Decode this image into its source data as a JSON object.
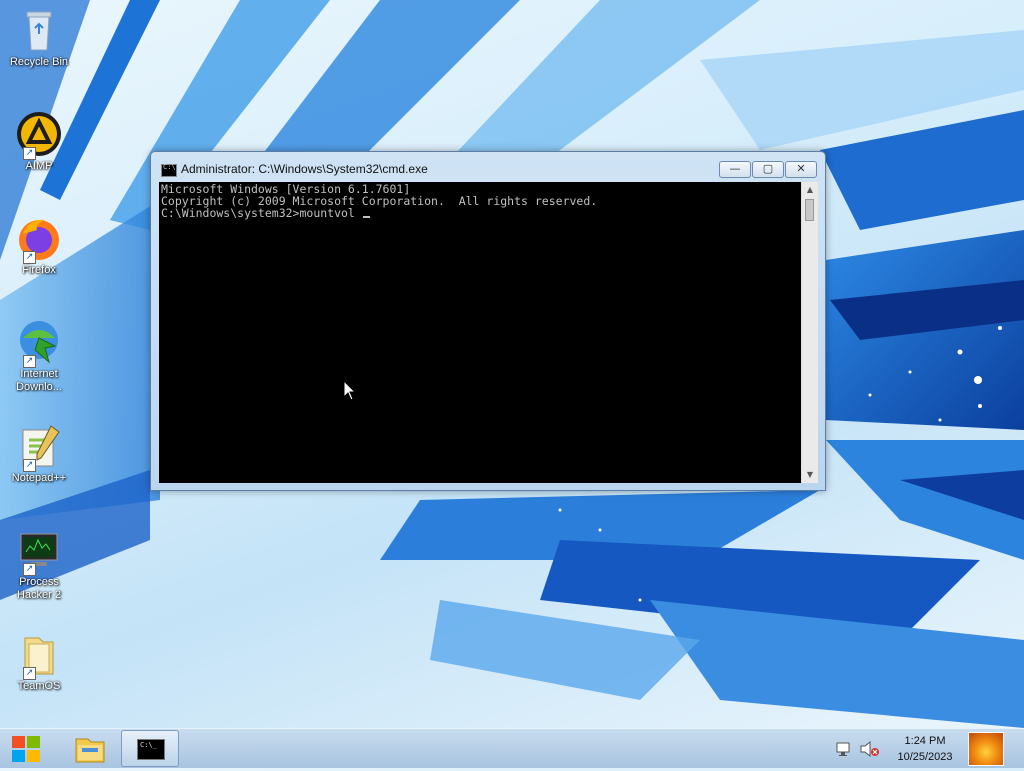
{
  "desktop": {
    "icons": [
      {
        "label": "Recycle Bin"
      },
      {
        "label": "AIMP"
      },
      {
        "label": "Firefox"
      },
      {
        "label": "Internet Downlo..."
      },
      {
        "label": "Notepad++"
      },
      {
        "label": "Process Hacker 2"
      },
      {
        "label": "TeamOS"
      }
    ]
  },
  "cmd_window": {
    "title": "Administrator: C:\\Windows\\System32\\cmd.exe",
    "minimize_glyph": "—",
    "maximize_glyph": "▢",
    "close_glyph": "✕",
    "console_lines": [
      "Microsoft Windows [Version 6.1.7601]",
      "Copyright (c) 2009 Microsoft Corporation.  All rights reserved.",
      "",
      "C:\\Windows\\system32>mountvol "
    ]
  },
  "taskbar": {
    "clock_time": "1:24 PM",
    "clock_date": "10/25/2023"
  },
  "colors": {
    "console_bg": "#000000",
    "console_fg": "#c0c0c0",
    "accent_blue": "#1f6fd0"
  }
}
